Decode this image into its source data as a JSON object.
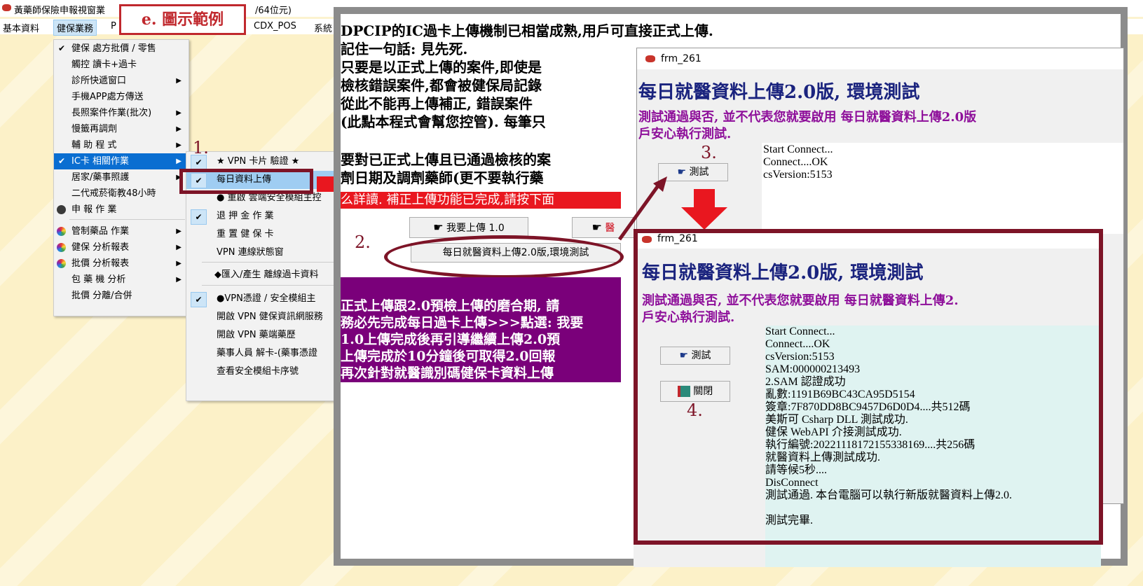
{
  "titlebar": {
    "title_left": "黃藥師保險申報視窗業",
    "title_right": "/64位元)"
  },
  "menubar": {
    "items": [
      "基本資料",
      "健保業務",
      "P",
      "CDX_POS",
      "系統"
    ]
  },
  "legend": {
    "label": "e. 圖示範例"
  },
  "menu1": {
    "items": [
      {
        "label": "健保 處方批價 / 零售",
        "check": "✔",
        "arrow": ""
      },
      {
        "label": "觸控 讀卡+過卡",
        "check": "",
        "arrow": ""
      },
      {
        "label": "診所快遞窗口",
        "check": "",
        "arrow": "▶"
      },
      {
        "label": "手機APP處方傳送",
        "check": "",
        "arrow": ""
      },
      {
        "label": "長照案件作業(批次)",
        "check": "",
        "arrow": "▶"
      },
      {
        "label": "慢籤再調劑",
        "check": "",
        "arrow": "▶"
      },
      {
        "label": "輔 助 程 式",
        "check": "",
        "arrow": "▶"
      },
      {
        "label": "IC卡 相關作業",
        "check": "✔",
        "arrow": "▶"
      },
      {
        "label": "居家/藥事照護",
        "check": "",
        "arrow": "▶"
      },
      {
        "label": "二代戒菸衛教48小時",
        "check": "",
        "arrow": ""
      },
      {
        "label": "申 報 作 業",
        "check": "",
        "arrow": ""
      },
      {
        "label": "管制藥品 作業",
        "check": "",
        "arrow": "▶"
      },
      {
        "label": "健保 分析報表",
        "check": "",
        "arrow": "▶"
      },
      {
        "label": "批價 分析報表",
        "check": "",
        "arrow": "▶"
      },
      {
        "label": "包 藥 機 分析",
        "check": "",
        "arrow": "▶"
      },
      {
        "label": "批價 分離/合併",
        "check": "",
        "arrow": ""
      }
    ]
  },
  "menu2": {
    "items": [
      {
        "label": "★ VPN 卡片 驗證 ★",
        "check": "✔"
      },
      {
        "label": "每日資料上傳",
        "check": "✔"
      },
      {
        "label": "● 重啟 雲端安全模組主控",
        "check": ""
      },
      {
        "label": "退 押 金 作 業",
        "check": "✔"
      },
      {
        "label": "重 置 健 保 卡",
        "check": ""
      },
      {
        "label": "VPN 連線狀態窗",
        "check": ""
      },
      {
        "label": "◆匯入/產生 離線過卡資料",
        "check": ""
      },
      {
        "label": "●VPN憑證 / 安全模組主",
        "check": "✔"
      },
      {
        "label": "開啟 VPN 健保資訊網服務",
        "check": ""
      },
      {
        "label": "開啟 VPN 藥端藥歷",
        "check": ""
      },
      {
        "label": "藥事人員 解卡-(藥事憑證",
        "check": ""
      },
      {
        "label": "查看安全模組卡序號",
        "check": ""
      }
    ]
  },
  "steps": {
    "s1": "1.",
    "s2": "2.",
    "s3": "3.",
    "s4": "4."
  },
  "background_window": {
    "lines": [
      "DPCIP的IC過卡上傳機制已相當成熟,用戶可直接正式上傳.",
      "記住一句話: 見先死.",
      " 只要是以正式上傳的案件,即使是",
      "檢核錯誤案件,都會被健保局記錄",
      "從此不能再上傳補正, 錯誤案件",
      "(此點本程式會幫您控管). 每筆只",
      "要對已正式上傳且已通過檢核的案",
      "劑日期及調劑藥師(更不要執行藥"
    ],
    "red_strip": "么詳讀. 補正上傳功能已完成,請按下面",
    "upload_btn": "我要上傳 1.0",
    "upload_btn2": "醫",
    "test_env_btn": "每日就醫資料上傳2.0版,環境測試",
    "purple_lines": [
      "正式上傳跟2.0預檢上傳的磨合期, 請",
      "務必先完成每日過卡上傳>>>點選: 我要",
      "1.0上傳完成後再引導繼續上傳2.0預",
      "上傳完成於10分鐘後可取得2.0回報",
      "再次針對就醫識別碼健保卡資料上傳"
    ]
  },
  "frm1": {
    "title": "frm_261",
    "heading": "每日就醫資料上傳2.0版, 環境測試",
    "sub1": "測試通過與否, 並不代表您就要啟用  每日就醫資料上傳2.0版",
    "sub2": "戶安心執行測試.",
    "test_btn": "測試",
    "log": [
      "Start Connect...",
      "Connect....OK",
      "csVersion:5153"
    ]
  },
  "frm2": {
    "title": "frm_261",
    "heading": "每日就醫資料上傳2.0版, 環境測試",
    "sub1": "測試通過與否, 並不代表您就要啟用  每日就醫資料上傳2.",
    "sub2": "戶安心執行測試.",
    "test_btn": "測試",
    "close_btn": "關閉",
    "log": [
      "Start Connect...",
      "Connect....OK",
      "csVersion:5153",
      "SAM:000000213493",
      "2.SAM 認證成功",
      "亂數:1191B69BC43CA95D5154",
      "簽章:7F870DD8BC9457D6D0D4....共512碼",
      "美斯可 Csharp DLL 測試成功.",
      "健保 WebAPI 介接測試成功.",
      "執行編號:20221118172155338169....共256碼",
      "就醫資料上傳測試成功.",
      "請等候5秒....",
      "DisConnect",
      "測試通過. 本台電腦可以執行新版就醫資料上傳2.0.",
      "",
      "測試完畢."
    ]
  },
  "colors": {
    "accent_red": "#e9171f",
    "frame_maroon": "#7d1427",
    "heading_blue": "#1a237e",
    "heading_purple": "#8e0f9a"
  }
}
